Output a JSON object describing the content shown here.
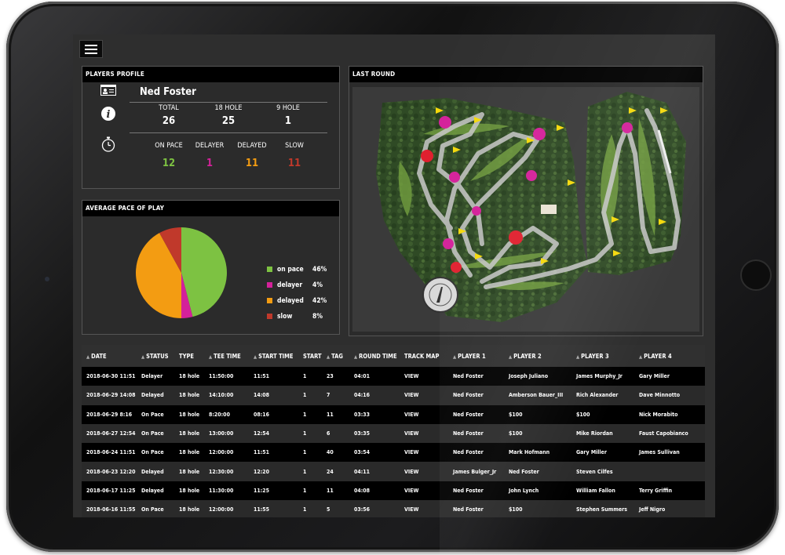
{
  "profile": {
    "title": "PLAYERS PROFILE",
    "name": "Ned Foster",
    "rounds": [
      {
        "label": "TOTAL",
        "value": "26"
      },
      {
        "label": "18 HOLE",
        "value": "25"
      },
      {
        "label": "9 HOLE",
        "value": "1"
      }
    ],
    "pace": [
      {
        "label": "ON PACE",
        "value": "12",
        "color": "#7dc242"
      },
      {
        "label": "DELAYER",
        "value": "1",
        "color": "#d4219a"
      },
      {
        "label": "DELAYED",
        "value": "11",
        "color": "#f39c12"
      },
      {
        "label": "SLOW",
        "value": "11",
        "color": "#c0392b"
      }
    ],
    "icons": [
      "id-card-icon",
      "info-icon",
      "stopwatch-icon"
    ]
  },
  "pace_panel": {
    "title": "AVERAGE PACE OF PLAY"
  },
  "chart_data": {
    "type": "pie",
    "categories": [
      "on pace",
      "delayer",
      "delayed",
      "slow"
    ],
    "values": [
      46,
      4,
      42,
      8
    ],
    "labels": [
      "46%",
      "4%",
      "42%",
      "8%"
    ],
    "colors": [
      "#7dc242",
      "#d4219a",
      "#f39c12",
      "#c0392b"
    ],
    "legend": "right"
  },
  "round_panel": {
    "title": "LAST ROUND"
  },
  "table": {
    "headers": [
      "DATE",
      "STATUS",
      "TYPE",
      "TEE TIME",
      "START TIME",
      "START",
      "TAG",
      "ROUND TIME",
      "TRACK MAP",
      "PLAYER 1",
      "PLAYER 2",
      "PLAYER 3",
      "PLAYER 4"
    ],
    "sortable": [
      true,
      true,
      false,
      true,
      true,
      false,
      true,
      true,
      false,
      true,
      true,
      true,
      true
    ],
    "rows": [
      [
        "2018-06-30 11:51",
        "Delayer",
        "18 hole",
        "11:50:00",
        "11:51",
        "1",
        "23",
        "04:01",
        "VIEW",
        "Ned Foster",
        "Joseph Juliano",
        "James Murphy_Jr",
        "Gary Miller"
      ],
      [
        "2018-06-29 14:08",
        "Delayed",
        "18 hole",
        "14:10:00",
        "14:08",
        "1",
        "7",
        "04:16",
        "VIEW",
        "Ned Foster",
        "Amberson Bauer_III",
        "Rich Alexander",
        "Dave Minnotto"
      ],
      [
        "2018-06-29 8:16",
        "On Pace",
        "18 hole",
        "8:20:00",
        "08:16",
        "1",
        "11",
        "03:33",
        "VIEW",
        "Ned Foster",
        "$100",
        "$100",
        "Nick Morabito"
      ],
      [
        "2018-06-27 12:54",
        "On Pace",
        "18 hole",
        "13:00:00",
        "12:54",
        "1",
        "6",
        "03:35",
        "VIEW",
        "Ned Foster",
        "$100",
        "Mike Riordan",
        "Faust Capobianco"
      ],
      [
        "2018-06-24 11:51",
        "On Pace",
        "18 hole",
        "12:00:00",
        "11:51",
        "1",
        "40",
        "03:54",
        "VIEW",
        "Ned Foster",
        "Mark Hofmann",
        "Gary Miller",
        "James Sullivan"
      ],
      [
        "2018-06-23 12:20",
        "Delayed",
        "18 hole",
        "12:30:00",
        "12:20",
        "1",
        "24",
        "04:11",
        "VIEW",
        "James Bulger_Jr",
        "Ned Foster",
        "Steven Cilfes",
        ""
      ],
      [
        "2018-06-17 11:25",
        "Delayed",
        "18 hole",
        "11:30:00",
        "11:25",
        "1",
        "11",
        "04:08",
        "VIEW",
        "Ned Foster",
        "John Lynch",
        "William Fallon",
        "Terry Griffin"
      ],
      [
        "2018-06-16 11:55",
        "On Pace",
        "18 hole",
        "12:00:00",
        "11:55",
        "1",
        "5",
        "03:56",
        "VIEW",
        "Ned Foster",
        "$100",
        "Stephen Summers",
        "Jeff Nigro"
      ]
    ]
  }
}
